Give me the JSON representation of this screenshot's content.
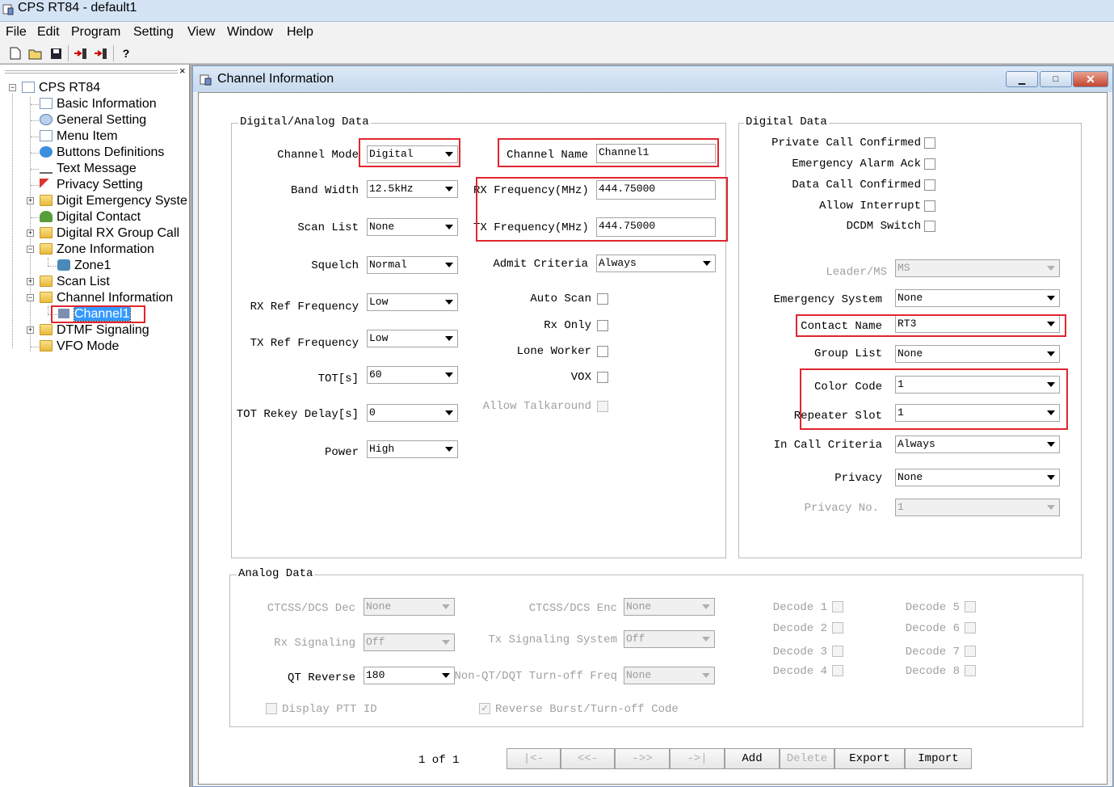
{
  "app": {
    "title": "CPS RT84 - default1"
  },
  "menu": [
    "File",
    "Edit",
    "Program",
    "Setting",
    "View",
    "Window",
    "Help"
  ],
  "toolbar": {
    "icons": [
      "new-icon",
      "open-icon",
      "save-icon",
      "read-radio-icon",
      "write-radio-icon",
      "help-icon"
    ],
    "help_glyph": "?"
  },
  "tree": {
    "close_glyph": "×",
    "root": "CPS RT84",
    "items": [
      "Basic Information",
      "General Setting",
      "Menu Item",
      "Buttons Definitions",
      "Text Message",
      "Privacy Setting",
      "Digit Emergency Syste",
      "Digital Contact",
      "Digital RX Group Call",
      "Zone Information",
      "Zone1",
      "Scan List",
      "Channel Information",
      "Channel1",
      "DTMF Signaling",
      "VFO Mode"
    ],
    "expanders": {
      "root": "−",
      "digit_emergency": "+",
      "digital_rx": "+",
      "zone_info": "−",
      "scan_list": "+",
      "channel_info": "−",
      "dtmf": "+"
    }
  },
  "window": {
    "title": "Channel Information",
    "min_glyph": "▁",
    "max_glyph": "□",
    "close_glyph": "✕"
  },
  "da": {
    "group": "Digital/Analog Data",
    "channel_mode": {
      "label": "Channel Mode",
      "value": "Digital"
    },
    "band_width": {
      "label": "Band Width",
      "value": "12.5kHz"
    },
    "scan_list": {
      "label": "Scan List",
      "value": "None"
    },
    "squelch": {
      "label": "Squelch",
      "value": "Normal"
    },
    "rx_ref": {
      "label": "RX Ref Frequency",
      "value": "Low"
    },
    "tx_ref": {
      "label": "TX Ref Frequency",
      "value": "Low"
    },
    "tot": {
      "label": "TOT[s]",
      "value": "60"
    },
    "tot_rekey": {
      "label": "TOT Rekey Delay[s]",
      "value": "0"
    },
    "power": {
      "label": "Power",
      "value": "High"
    },
    "channel_name": {
      "label": "Channel Name",
      "value": "Channel1"
    },
    "rx_freq": {
      "label": "RX Frequency(MHz)",
      "value": "444.75000"
    },
    "tx_freq": {
      "label": "TX Frequency(MHz)",
      "value": "444.75000"
    },
    "admit": {
      "label": "Admit Criteria",
      "value": "Always"
    },
    "auto_scan": {
      "label": "Auto Scan",
      "checked": false
    },
    "rx_only": {
      "label": "Rx Only",
      "checked": false
    },
    "lone_worker": {
      "label": "Lone Worker",
      "checked": false
    },
    "vox": {
      "label": "VOX",
      "checked": false
    },
    "talkaround": {
      "label": "Allow Talkaround",
      "checked": false
    }
  },
  "dd": {
    "group": "Digital Data",
    "private_call": {
      "label": "Private Call Confirmed",
      "checked": false
    },
    "emergency_ack": {
      "label": "Emergency Alarm Ack",
      "checked": false
    },
    "data_call": {
      "label": "Data Call Confirmed",
      "checked": false
    },
    "allow_interrupt": {
      "label": "Allow Interrupt",
      "checked": false
    },
    "dcdm": {
      "label": "DCDM Switch",
      "checked": false
    },
    "leader": {
      "label": "Leader/MS",
      "value": "MS"
    },
    "emergency_system": {
      "label": "Emergency System",
      "value": "None"
    },
    "contact_name": {
      "label": "Contact Name",
      "value": "RT3"
    },
    "group_list": {
      "label": "Group List",
      "value": "None"
    },
    "color_code": {
      "label": "Color Code",
      "value": "1"
    },
    "repeater_slot": {
      "label": "Repeater Slot",
      "value": "1"
    },
    "in_call": {
      "label": "In Call Criteria",
      "value": "Always"
    },
    "privacy": {
      "label": "Privacy",
      "value": "None"
    },
    "privacy_no": {
      "label": "Privacy No.",
      "value": "1"
    }
  },
  "an": {
    "group": "Analog Data",
    "ctcss_dec": {
      "label": "CTCSS/DCS Dec",
      "value": "None"
    },
    "rx_signaling": {
      "label": "Rx Signaling",
      "value": "Off"
    },
    "qt_reverse": {
      "label": "QT Reverse",
      "value": "180"
    },
    "ctcss_enc": {
      "label": "CTCSS/DCS Enc",
      "value": "None"
    },
    "tx_signaling": {
      "label": "Tx Signaling System",
      "value": "Off"
    },
    "nonqt": {
      "label": "Non-QT/DQT Turn-off Freq",
      "value": "None"
    },
    "display_ptt": {
      "label": "Display PTT ID",
      "checked": false
    },
    "reverse_burst": {
      "label": "Reverse Burst/Turn-off Code",
      "checked": true
    },
    "decodes": [
      "Decode 1",
      "Decode 2",
      "Decode 3",
      "Decode 4",
      "Decode 5",
      "Decode 6",
      "Decode 7",
      "Decode 8"
    ]
  },
  "nav": {
    "page": "1 of 1",
    "first": "|<-",
    "prev": "<<-",
    "next": "->>",
    "last": "->|",
    "add": "Add",
    "delete": "Delete",
    "export": "Export",
    "import": "Import"
  },
  "colors": {
    "highlight": "#e0262f",
    "selection": "#3399ff"
  }
}
